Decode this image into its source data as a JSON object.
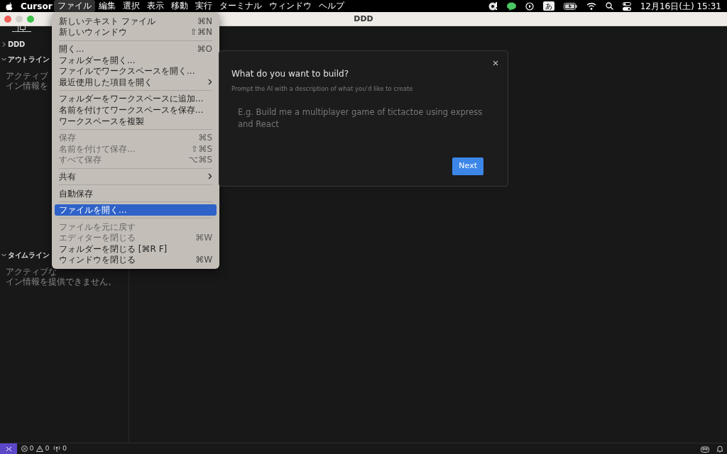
{
  "menubar": {
    "app_name": "Cursor",
    "menus": [
      {
        "label": "ファイル",
        "selected": true
      },
      {
        "label": "編集",
        "selected": false
      },
      {
        "label": "選択",
        "selected": false
      },
      {
        "label": "表示",
        "selected": false
      },
      {
        "label": "移動",
        "selected": false
      },
      {
        "label": "実行",
        "selected": false
      },
      {
        "label": "ターミナル",
        "selected": false
      },
      {
        "label": "ウィンドウ",
        "selected": false
      },
      {
        "label": "ヘルプ",
        "selected": false
      }
    ],
    "input_mode": "あ",
    "clock": "12月16日(土) 15:31"
  },
  "window": {
    "title": "DDD"
  },
  "sidebar": {
    "sections": [
      {
        "title": "DDD",
        "expanded": false
      },
      {
        "title": "アウトライン",
        "expanded": true,
        "lines": [
          "アクティブ",
          "イン情報を"
        ]
      },
      {
        "title": "タイムライン",
        "expanded": true,
        "lines": [
          "アクティブな",
          "イン情報を提供できません。"
        ]
      }
    ]
  },
  "file_menu": {
    "items": [
      {
        "kind": "item",
        "label": "新しいテキスト ファイル",
        "shortcut": "⌘N",
        "disabled": false,
        "selected": false
      },
      {
        "kind": "item",
        "label": "新しいウィンドウ",
        "shortcut": "⇧⌘N",
        "disabled": false,
        "selected": false
      },
      {
        "kind": "separator"
      },
      {
        "kind": "item",
        "label": "開く...",
        "shortcut": "⌘O",
        "disabled": false,
        "selected": false
      },
      {
        "kind": "item",
        "label": "フォルダーを開く...",
        "disabled": false,
        "selected": false
      },
      {
        "kind": "item",
        "label": "ファイルでワークスペースを開く...",
        "disabled": false,
        "selected": false
      },
      {
        "kind": "submenu",
        "label": "最近使用した項目を開く",
        "disabled": false,
        "selected": false
      },
      {
        "kind": "separator"
      },
      {
        "kind": "item",
        "label": "フォルダーをワークスペースに追加...",
        "disabled": false,
        "selected": false
      },
      {
        "kind": "item",
        "label": "名前を付けてワークスペースを保存...",
        "disabled": false,
        "selected": false
      },
      {
        "kind": "item",
        "label": "ワークスペースを複製",
        "disabled": false,
        "selected": false
      },
      {
        "kind": "separator"
      },
      {
        "kind": "item",
        "label": "保存",
        "shortcut": "⌘S",
        "disabled": true,
        "selected": false
      },
      {
        "kind": "item",
        "label": "名前を付けて保存...",
        "shortcut": "⇧⌘S",
        "disabled": true,
        "selected": false
      },
      {
        "kind": "item",
        "label": "すべて保存",
        "shortcut": "⌥⌘S",
        "disabled": true,
        "selected": false
      },
      {
        "kind": "separator"
      },
      {
        "kind": "submenu",
        "label": "共有",
        "disabled": false,
        "selected": false
      },
      {
        "kind": "separator"
      },
      {
        "kind": "item",
        "label": "自動保存",
        "disabled": false,
        "selected": false
      },
      {
        "kind": "separator"
      },
      {
        "kind": "item",
        "label": "ファイルを開く...",
        "disabled": false,
        "selected": true
      },
      {
        "kind": "separator"
      },
      {
        "kind": "item",
        "label": "ファイルを元に戻す",
        "disabled": true,
        "selected": false
      },
      {
        "kind": "item",
        "label": "エディターを閉じる",
        "shortcut": "⌘W",
        "disabled": true,
        "selected": false
      },
      {
        "kind": "item",
        "label": "フォルダーを閉じる [⌘R F]",
        "disabled": false,
        "selected": false
      },
      {
        "kind": "item",
        "label": "ウィンドウを閉じる",
        "shortcut": "⌘W",
        "disabled": false,
        "selected": false
      }
    ]
  },
  "dialog": {
    "title": "What do you want to build?",
    "subtitle": "Prompt the AI with a description of what you'd like to create",
    "placeholder": "E.g. Build me a multiplayer game of tictactoe using express and React",
    "button": "Next"
  },
  "status_bar": {
    "errors": "0",
    "warnings": "0",
    "ports": "0"
  }
}
